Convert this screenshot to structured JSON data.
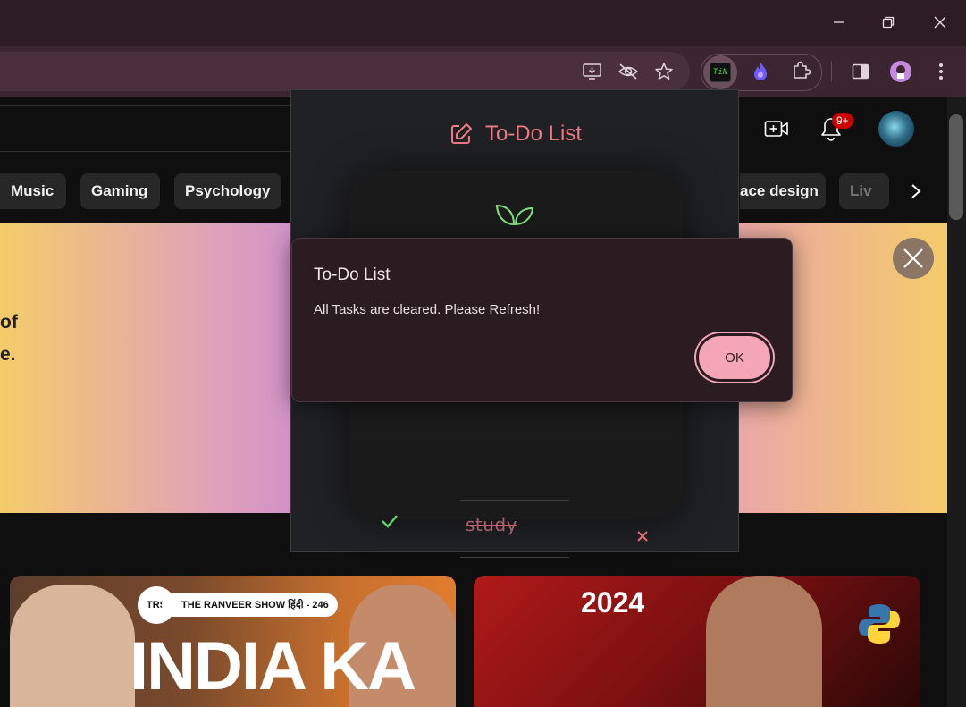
{
  "browser": {
    "window_controls": [
      "minimize",
      "restore",
      "close"
    ],
    "extension_label": "TiN"
  },
  "youtube": {
    "notification_count": "9+",
    "chips": [
      "Music",
      "Gaming",
      "Psychology",
      "ace design",
      "Liv"
    ],
    "banner_lines": [
      "of",
      "e."
    ],
    "thumbnail1": {
      "badge": "TRS",
      "show": "THE RANVEER SHOW हिंदी - 246",
      "headline": "INDIA KA"
    },
    "thumbnail2": {
      "year": "2024"
    }
  },
  "popup": {
    "title": "To-Do List",
    "tasks": [
      {
        "text": "study",
        "done": true
      }
    ]
  },
  "dialog": {
    "title": "To-Do List",
    "message": "All Tasks are cleared. Please Refresh!",
    "ok_label": "OK"
  },
  "colors": {
    "accent_pink": "#f07a86",
    "ok_button": "#f4a6b8",
    "check_green": "#5fd36a",
    "dialog_bg": "#2a1c21"
  }
}
